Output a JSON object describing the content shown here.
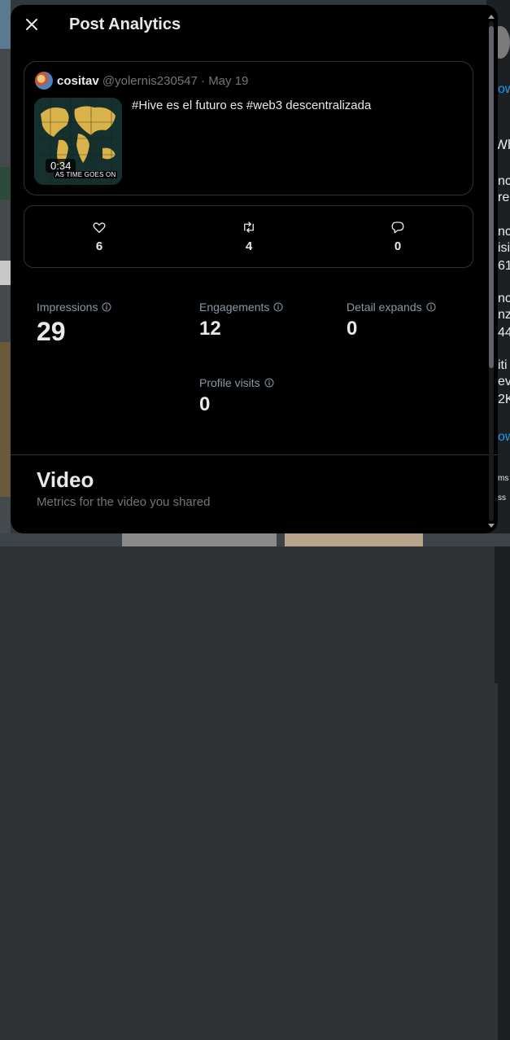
{
  "modal": {
    "title": "Post Analytics"
  },
  "post": {
    "author_name": "cositav",
    "author_handle": "@yolernis230547",
    "separator": "·",
    "date": "May 19",
    "text": "#Hive es el futuro es #web3 descentralizada",
    "video_duration": "0:34",
    "thumbnail_caption": "AS TIME GOES ON"
  },
  "engagement_counts": {
    "likes": "6",
    "reposts": "4",
    "replies": "0"
  },
  "stats": {
    "impressions_label": "Impressions",
    "impressions_value": "29",
    "engagements_label": "Engagements",
    "engagements_value": "12",
    "detail_expands_label": "Detail expands",
    "detail_expands_value": "0",
    "profile_visits_label": "Profile visits",
    "profile_visits_value": "0"
  },
  "video_section": {
    "title": "Video",
    "subtitle": "Metrics for the video you shared"
  },
  "background": {
    "right_snippets": [
      "ow",
      "Wh",
      "nc",
      "re",
      "nc",
      "isi",
      "61",
      "nc",
      "nz",
      "44",
      "iti",
      "ev",
      "2K",
      "ow",
      "ms",
      "ss"
    ]
  },
  "colors": {
    "modal_bg": "#000000",
    "border": "#2f3336",
    "text_primary": "#e7e9ea",
    "text_secondary": "#71767b"
  }
}
